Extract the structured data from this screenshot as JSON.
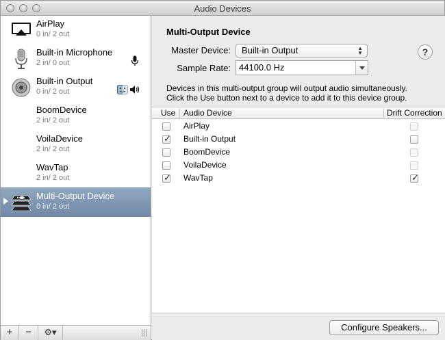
{
  "window": {
    "title": "Audio Devices"
  },
  "sidebar": {
    "devices": [
      {
        "name": "AirPlay",
        "io": "0 in/ 2 out",
        "icon": "airplay-icon"
      },
      {
        "name": "Built-in Microphone",
        "io": "2 in/ 0 out",
        "icon": "microphone-icon"
      },
      {
        "name": "Built-in Output",
        "io": "0 in/ 2 out",
        "icon": "speaker-icon"
      },
      {
        "name": "BoomDevice",
        "io": "2 in/ 2 out",
        "icon": ""
      },
      {
        "name": "VoilaDevice",
        "io": "2 in/ 2 out",
        "icon": ""
      },
      {
        "name": "WavTap",
        "io": "2 in/ 2 out",
        "icon": ""
      },
      {
        "name": "Multi-Output Device",
        "io": "0 in/ 2 out",
        "icon": "multi-output-icon",
        "selected": true
      }
    ],
    "toolbar": {
      "add": "+",
      "remove": "−",
      "gear": "⚙▾"
    }
  },
  "panel": {
    "heading": "Multi-Output Device",
    "master_label": "Master Device:",
    "master_value": "Built-in Output",
    "rate_label": "Sample Rate:",
    "rate_value": "44100.0 Hz",
    "help": "?",
    "desc_line1": "Devices in this multi-output group will output audio simultaneously.",
    "desc_line2": "Click the Use button next to a device to add it to this device group.",
    "table": {
      "col_use": "Use",
      "col_device": "Audio Device",
      "col_drift": "Drift Correction",
      "rows": [
        {
          "device": "AirPlay",
          "use": false,
          "drift": false,
          "drift_enabled": false
        },
        {
          "device": "Built-in Output",
          "use": true,
          "drift": false,
          "drift_enabled": true
        },
        {
          "device": "BoomDevice",
          "use": false,
          "drift": false,
          "drift_enabled": false
        },
        {
          "device": "VoilaDevice",
          "use": false,
          "drift": false,
          "drift_enabled": false
        },
        {
          "device": "WavTap",
          "use": true,
          "drift": true,
          "drift_enabled": true
        }
      ]
    },
    "configure_button": "Configure Speakers..."
  }
}
